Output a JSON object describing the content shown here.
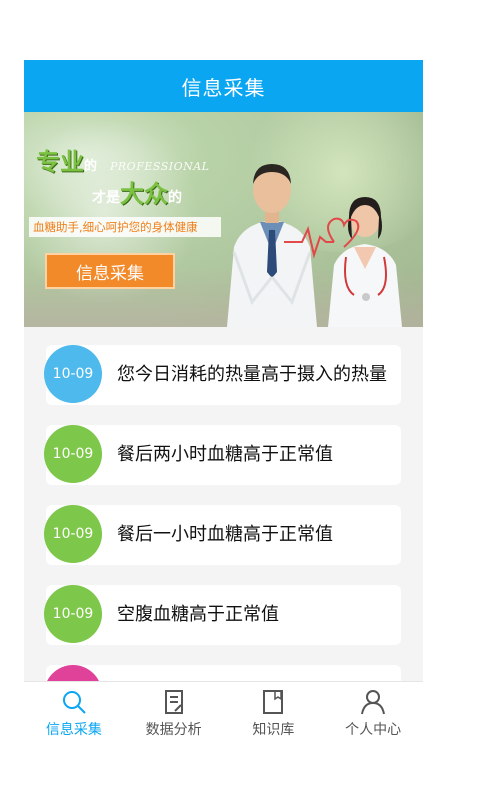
{
  "header": {
    "title": "信息采集"
  },
  "banner": {
    "slogan_a": "专业",
    "slogan_a_small": "的",
    "slogan_en": "PROFESSIONAL",
    "slogan_b_small": "才是",
    "slogan_b_big": "大众",
    "slogan_b_tail": "的",
    "subslogan": "血糖助手,细心呵护您的身体健康",
    "button_label": "信息采集"
  },
  "notifications": [
    {
      "date": "10-09",
      "text": "您今日消耗的热量高于摄入的热量",
      "color": "#4db9ec"
    },
    {
      "date": "10-09",
      "text": "餐后两小时血糖高于正常值",
      "color": "#7dc74a"
    },
    {
      "date": "10-09",
      "text": "餐后一小时血糖高于正常值",
      "color": "#7dc74a"
    },
    {
      "date": "10-09",
      "text": "空腹血糖高于正常值",
      "color": "#7dc74a"
    },
    {
      "date": "",
      "text": "",
      "color": "#e0429a"
    }
  ],
  "tabs": [
    {
      "label": "信息采集",
      "icon": "search-icon",
      "active": true
    },
    {
      "label": "数据分析",
      "icon": "document-edit-icon",
      "active": false
    },
    {
      "label": "知识库",
      "icon": "book-icon",
      "active": false
    },
    {
      "label": "个人中心",
      "icon": "person-icon",
      "active": false
    }
  ],
  "colors": {
    "accent": "#0aa6f2",
    "orange": "#f38a2a",
    "green": "#7cc242"
  }
}
